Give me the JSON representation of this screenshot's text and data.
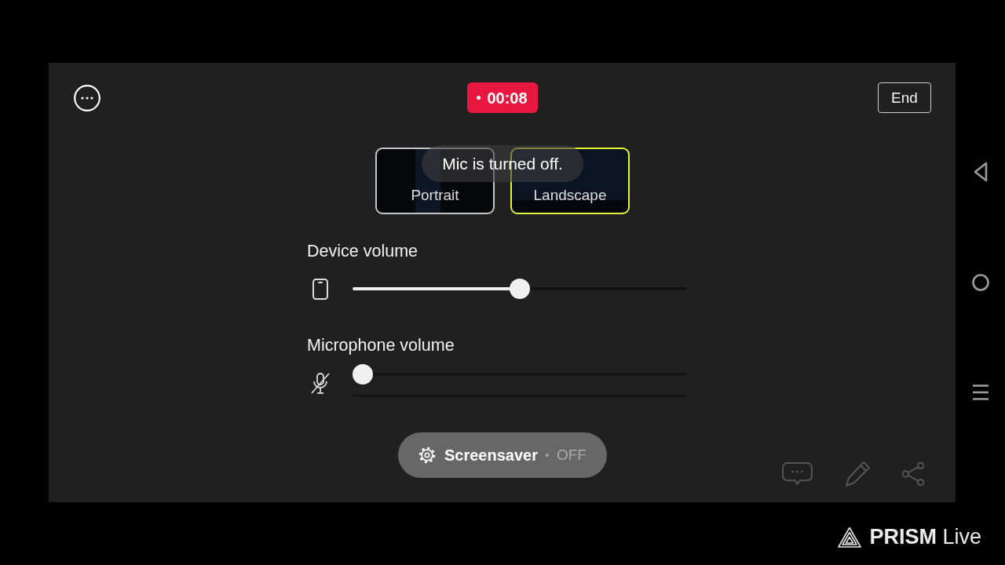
{
  "recording": {
    "timer": "00:08"
  },
  "end_button": {
    "label": "End"
  },
  "orientations": [
    {
      "label": "Portrait",
      "selected": false
    },
    {
      "label": "Landscape",
      "selected": true
    }
  ],
  "toast": {
    "text": "Mic is turned off."
  },
  "volumes": [
    {
      "kind": "device",
      "label": "Device volume",
      "muted": false,
      "level": 0.5
    },
    {
      "kind": "microphone",
      "label": "Microphone volume",
      "muted": true,
      "level": 0
    }
  ],
  "screensaver": {
    "label": "Screensaver",
    "status": "OFF"
  },
  "watermark": {
    "text": "**PRISM** Live"
  }
}
